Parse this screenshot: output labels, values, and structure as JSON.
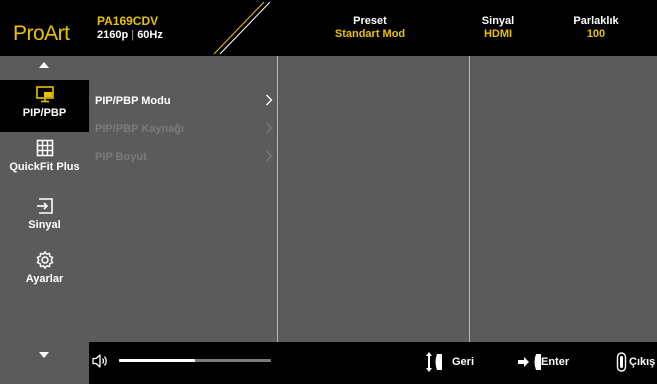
{
  "header": {
    "logo": "ProArt",
    "model": "PA169CDV",
    "resolution": "2160p",
    "refresh": "60Hz",
    "preset_title": "Preset",
    "preset_value": "Standart Mod",
    "signal_title": "Sinyal",
    "signal_value": "HDMI",
    "brightness_title": "Parlaklık",
    "brightness_value": "100"
  },
  "sidebar": {
    "items": [
      {
        "label": "PIP/PBP",
        "icon": "pip-monitor-icon",
        "active": true
      },
      {
        "label": "QuickFit Plus",
        "icon": "grid-icon",
        "active": false
      },
      {
        "label": "Sinyal",
        "icon": "input-icon",
        "active": false
      },
      {
        "label": "Ayarlar",
        "icon": "gear-icon",
        "active": false
      }
    ]
  },
  "submenu": {
    "items": [
      {
        "label": "PIP/PBP Modu",
        "enabled": true
      },
      {
        "label": "PIP/PBP Kaynağı",
        "enabled": false
      },
      {
        "label": "PIP Boyut",
        "enabled": false
      }
    ]
  },
  "footer": {
    "volume_level": 0.5,
    "back_label": "Geri",
    "enter_label": "Enter",
    "exit_label": "Çıkış"
  },
  "colors": {
    "accent": "#e8c200",
    "panel": "#5b5b5b",
    "background": "#000000",
    "disabled_text": "#7b7b7b"
  }
}
